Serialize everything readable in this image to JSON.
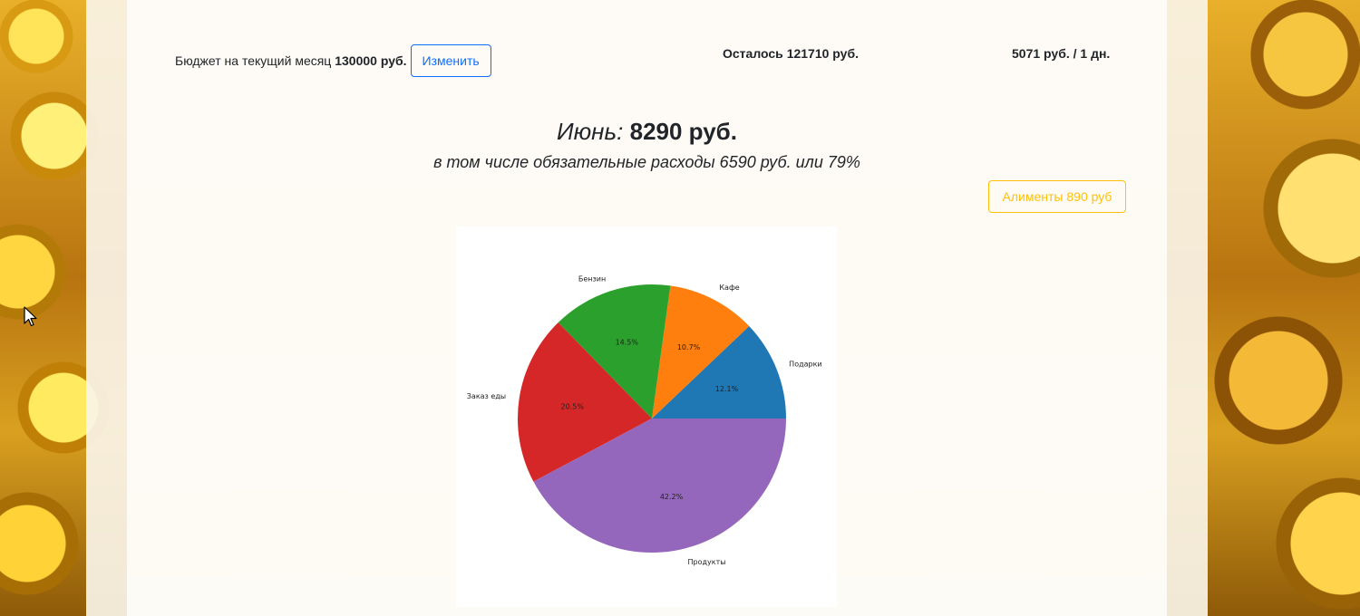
{
  "header": {
    "budget_label": "Бюджет на текущий месяц",
    "budget_value": "130000 руб.",
    "edit_button": "Изменить",
    "remaining_label": "Осталось",
    "remaining_value": "121710 руб.",
    "per_day": "5071 руб. / 1 дн."
  },
  "summary": {
    "month": "Июнь:",
    "total": "8290 руб.",
    "mandatory_note": "в том числе обязательные расходы 6590 руб. или 79%"
  },
  "alimony_button": "Алименты 890 руб",
  "chart_data": {
    "type": "pie",
    "title": "",
    "start_angle_deg": 0,
    "direction": "counterclockwise",
    "slices": [
      {
        "label": "Подарки",
        "percent": 12.1,
        "pct_label": "12.1%",
        "color": "#1f77b4"
      },
      {
        "label": "Кафе",
        "percent": 10.7,
        "pct_label": "10.7%",
        "color": "#ff7f0e"
      },
      {
        "label": "Бензин",
        "percent": 14.5,
        "pct_label": "14.5%",
        "color": "#2ca02c"
      },
      {
        "label": "Заказ еды",
        "percent": 20.5,
        "pct_label": "20.5%",
        "color": "#d62728"
      },
      {
        "label": "Продукты",
        "percent": 42.2,
        "pct_label": "42.2%",
        "color": "#9467bd"
      }
    ]
  },
  "colors": {
    "primary": "#0d6efd",
    "warning": "#ffc107",
    "text": "#212529"
  }
}
